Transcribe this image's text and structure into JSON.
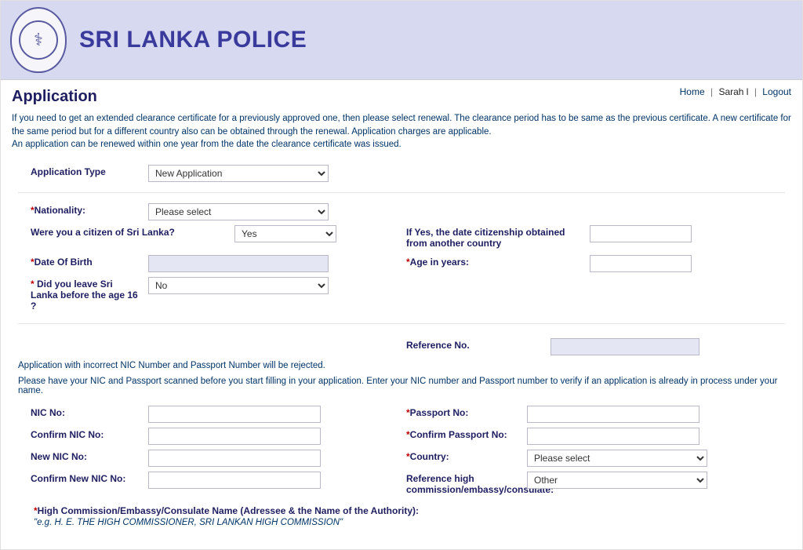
{
  "header": {
    "site_title": "SRI LANKA POLICE",
    "nav_home": "Home",
    "nav_user": "Sarah l",
    "nav_logout": "Logout"
  },
  "page": {
    "title": "Application",
    "intro_line1": "If you need to get an extended clearance certificate for a previously approved one, then please select renewal. The clearance period has to be same as the previous certificate. A new certificate for the same period but for a different country also can be obtained through the renewal. Application charges are applicable.",
    "intro_line2": "An application can be renewed within one year from the date the clearance certificate was issued."
  },
  "labels": {
    "application_type": "Application Type",
    "nationality": "Nationality:",
    "were_you_citizen": "Were you a citizen of Sri Lanka?",
    "if_yes_date": "If Yes, the date citizenship obtained from another country",
    "dob": "Date Of Birth",
    "age_in_years": "Age in years:",
    "did_you_leave": "Did you leave Sri Lanka before the age 16 ?",
    "reference_no": "Reference No.",
    "nic_no": "NIC No:",
    "confirm_nic": "Confirm NIC No:",
    "new_nic": "New NIC No:",
    "confirm_new_nic": "Confirm New NIC No:",
    "passport_no": "Passport No:",
    "confirm_passport": "Confirm Passport No:",
    "country": "Country:",
    "ref_high_comm": "Reference high commission/embassy/consulate:",
    "high_comm_name": "High Commission/Embassy/Consulate Name (Adressee & the Name of the Authority):",
    "high_comm_example": "\"e.g. H. E. THE HIGH COMMISSIONER, SRI LANKAN HIGH COMMISSION\""
  },
  "selects": {
    "application_type": "New Application",
    "nationality": "Please select",
    "citizen_yes": "Yes",
    "leave_no": "No",
    "country": "Please select",
    "ref_hc": "Other"
  },
  "notes": {
    "reject_note": "Application with incorrect NIC Number and Passport Number will be rejected.",
    "scan_note": "Please have your NIC and Passport scanned before you start filling in your application. Enter your NIC number and Passport number to verify if an application is already in process under your name."
  }
}
